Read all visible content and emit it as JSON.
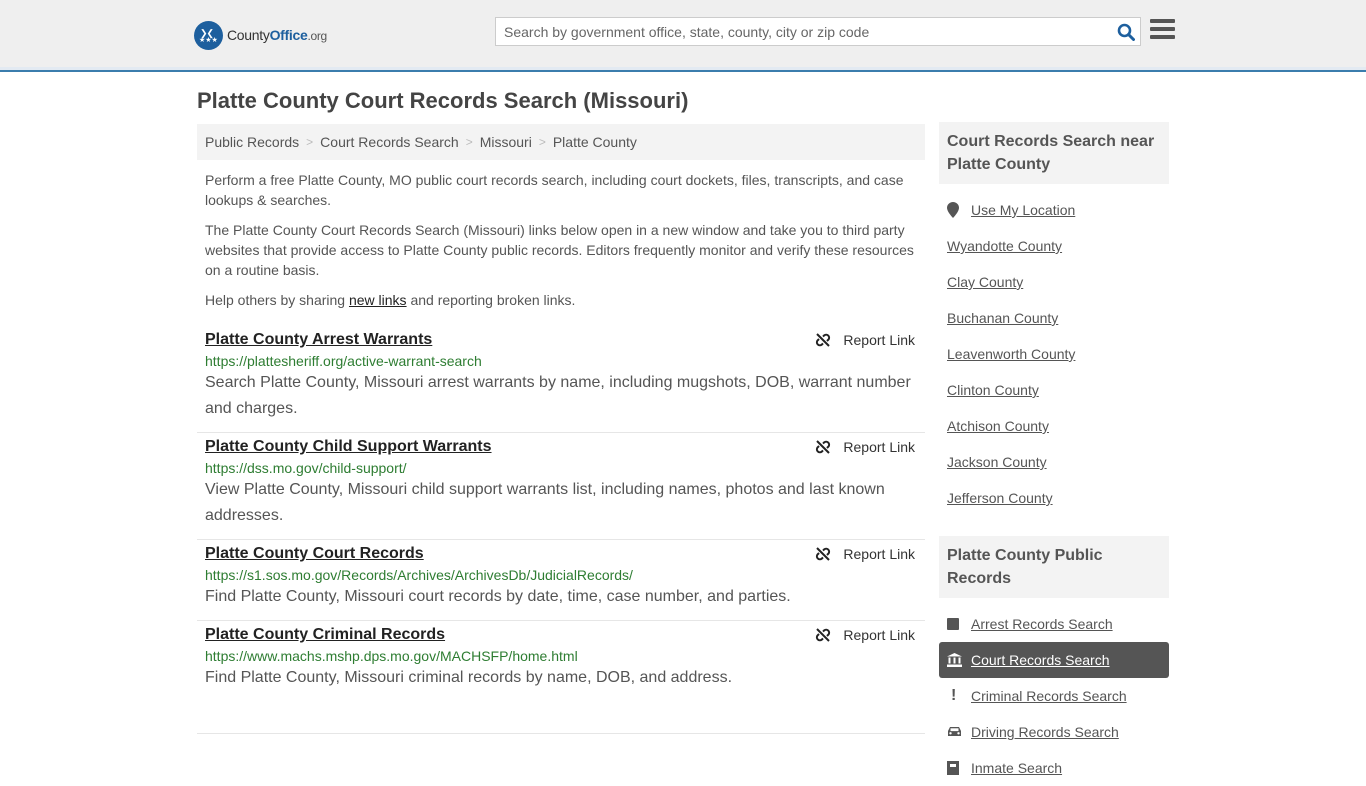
{
  "header": {
    "logo": {
      "name_part1": "County",
      "name_part2": "Office",
      "suffix": ".org"
    },
    "search": {
      "placeholder": "Search by government office, state, county, city or zip code",
      "value": ""
    }
  },
  "page": {
    "title": "Platte County Court Records Search (Missouri)",
    "breadcrumb": [
      "Public Records",
      "Court Records Search",
      "Missouri",
      "Platte County"
    ],
    "intro": {
      "p1": "Perform a free Platte County, MO public court records search, including court dockets, files, transcripts, and case lookups & searches.",
      "p2": "The Platte County Court Records Search (Missouri) links below open in a new window and take you to third party websites that provide access to Platte County public records. Editors frequently monitor and verify these resources on a routine basis.",
      "p3_before": "Help others by sharing ",
      "p3_link": "new links",
      "p3_after": " and reporting broken links."
    },
    "report_label": "Report Link",
    "results": [
      {
        "title": "Platte County Arrest Warrants",
        "url": "https://plattesheriff.org/active-warrant-search",
        "desc": "Search Platte County, Missouri arrest warrants by name, including mugshots, DOB, warrant number and charges."
      },
      {
        "title": "Platte County Child Support Warrants",
        "url": "https://dss.mo.gov/child-support/",
        "desc": "View Platte County, Missouri child support warrants list, including names, photos and last known addresses."
      },
      {
        "title": "Platte County Court Records",
        "url": "https://s1.sos.mo.gov/Records/Archives/ArchivesDb/JudicialRecords/",
        "desc": "Find Platte County, Missouri court records by date, time, case number, and parties."
      },
      {
        "title": "Platte County Criminal Records",
        "url": "https://www.machs.mshp.dps.mo.gov/MACHSFP/home.html",
        "desc": "Find Platte County, Missouri criminal records by name, DOB, and address."
      }
    ]
  },
  "sidebar": {
    "nearby": {
      "heading": "Court Records Search near Platte County",
      "use_location": "Use My Location",
      "counties": [
        "Wyandotte County",
        "Clay County",
        "Buchanan County",
        "Leavenworth County",
        "Clinton County",
        "Atchison County",
        "Jackson County",
        "Jefferson County"
      ]
    },
    "public_records": {
      "heading": "Platte County Public Records",
      "items": [
        {
          "label": "Arrest Records Search",
          "icon": "square-icon",
          "active": false
        },
        {
          "label": "Court Records Search",
          "icon": "courthouse-icon",
          "active": true
        },
        {
          "label": "Criminal Records Search",
          "icon": "exclamation-icon",
          "active": false
        },
        {
          "label": "Driving Records Search",
          "icon": "car-icon",
          "active": false
        },
        {
          "label": "Inmate Search",
          "icon": "jail-icon",
          "active": false
        }
      ]
    }
  },
  "colors": {
    "accent": "#1d5f9e",
    "url_green": "#2e7d32",
    "active_bg": "#555555",
    "header_border": "#3b7dad"
  }
}
